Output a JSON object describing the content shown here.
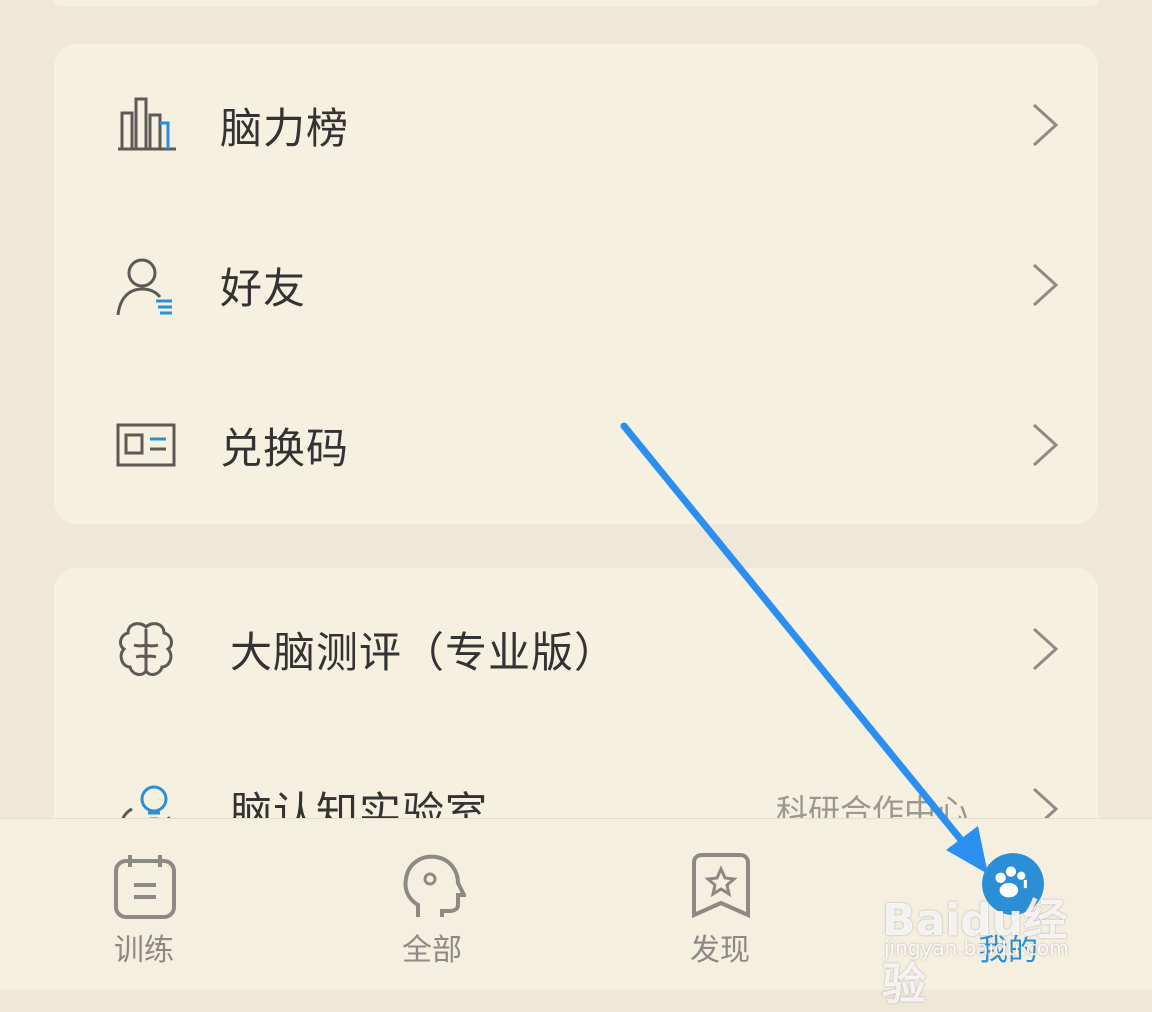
{
  "colors": {
    "background": "#efe8d8",
    "card": "#f6f0e1",
    "icon_stroke": "#5c5a55",
    "accent_blue": "#2b8fd8",
    "arrow_blue": "#2a8ff0"
  },
  "menu_group_1": [
    {
      "label": "脑力榜",
      "icon": "leaderboard-bar-chart-icon"
    },
    {
      "label": "好友",
      "icon": "friends-person-icon"
    },
    {
      "label": "兑换码",
      "icon": "redeem-code-card-icon"
    }
  ],
  "menu_group_2": [
    {
      "label": "大脑测评（专业版）",
      "icon": "brain-icon"
    },
    {
      "label": "脑认知实验室",
      "sublabel": "科研合作中心",
      "icon": "lightbulb-head-icon"
    }
  ],
  "tabbar": {
    "items": [
      {
        "label": "训练",
        "icon": "calendar-icon"
      },
      {
        "label": "全部",
        "icon": "head-icon"
      },
      {
        "label": "发现",
        "icon": "star-bookmark-icon"
      },
      {
        "label": "我的",
        "icon": "profile-paw-icon",
        "active": true
      }
    ]
  },
  "watermark": {
    "logo_text": "Baidu经验",
    "url": "jingyan.baidu.com"
  }
}
